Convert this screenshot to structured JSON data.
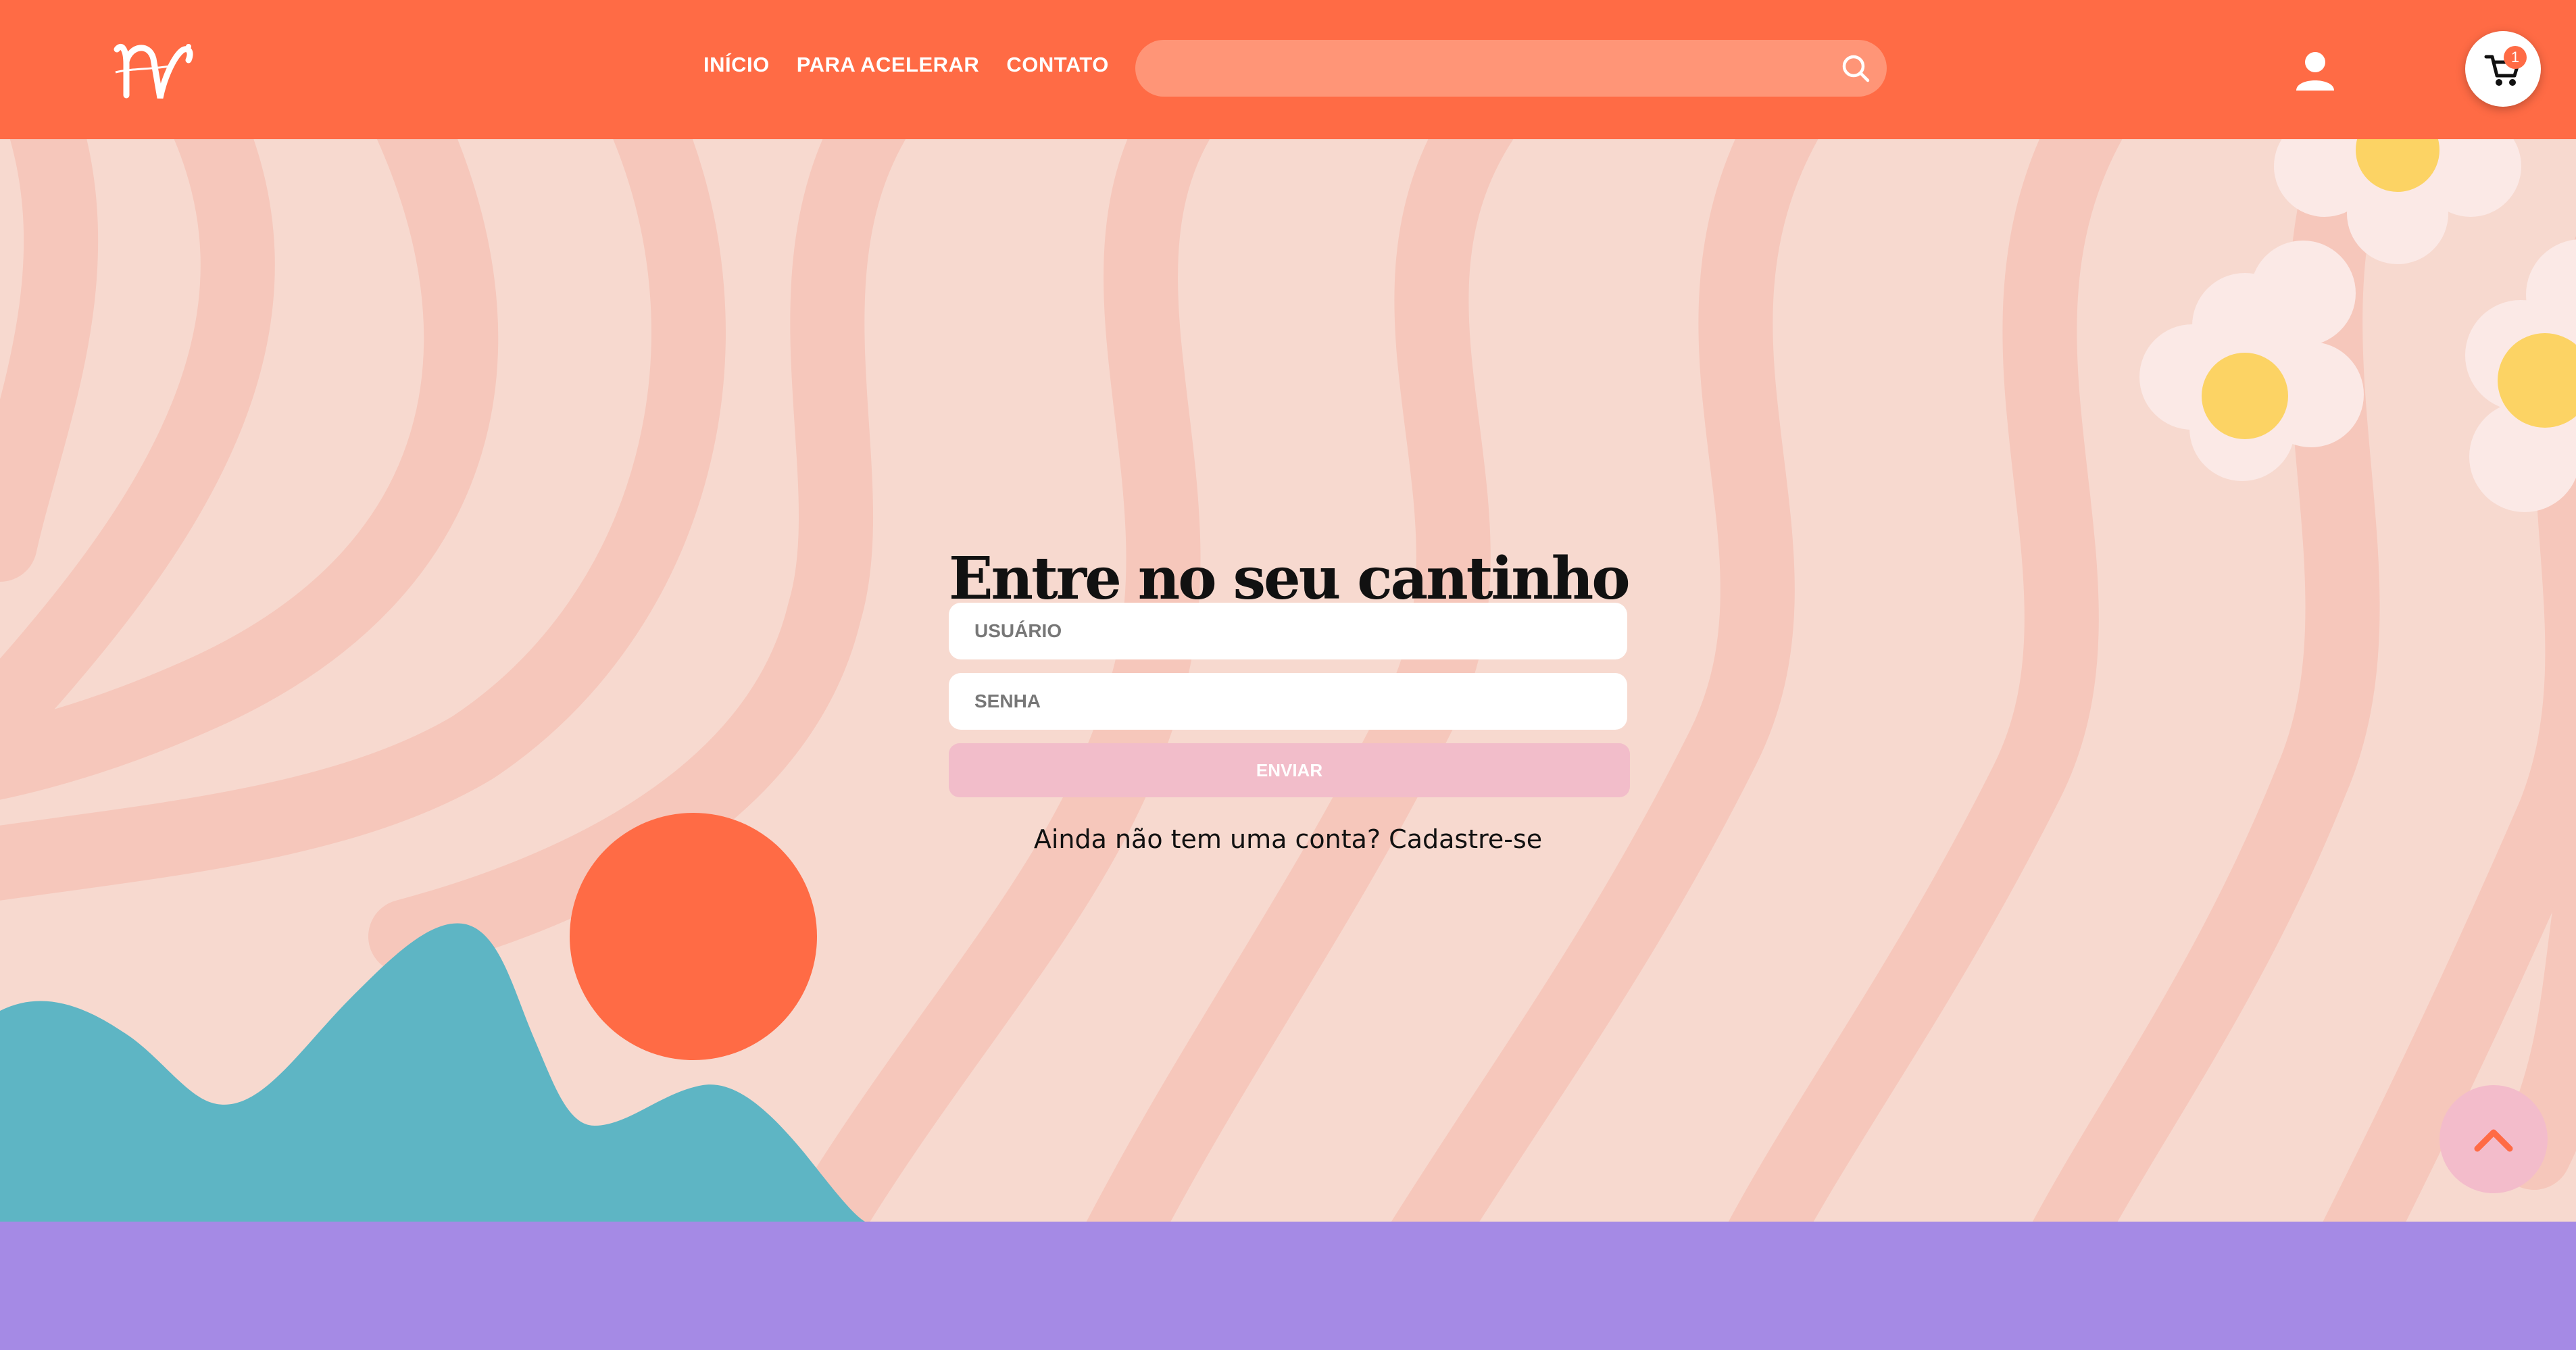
{
  "header": {
    "nav": [
      "INÍCIO",
      "PARA ACELERAR",
      "CONTATO"
    ],
    "search": {
      "placeholder": "",
      "value": ""
    },
    "cart": {
      "count": "1"
    }
  },
  "login": {
    "title": "Entre no seu cantinho",
    "username_placeholder": "USUÁRIO",
    "password_placeholder": "SENHA",
    "submit_label": "ENVIAR",
    "signup_question": "Ainda não tem uma conta?",
    "signup_link": "Cadastre-se"
  },
  "colors": {
    "header": "#ff6b45",
    "search": "#ff9577",
    "background": "#f7d9cf",
    "wave": "#f6c7bb",
    "button": "#f2bdca",
    "footer": "#a58ae5",
    "hill": "#5eb5c4",
    "sun": "#ff6b45",
    "flower_center": "#fcd364"
  },
  "icons": [
    "logo",
    "search-icon",
    "user-icon",
    "cart-icon",
    "chevron-up-icon"
  ]
}
